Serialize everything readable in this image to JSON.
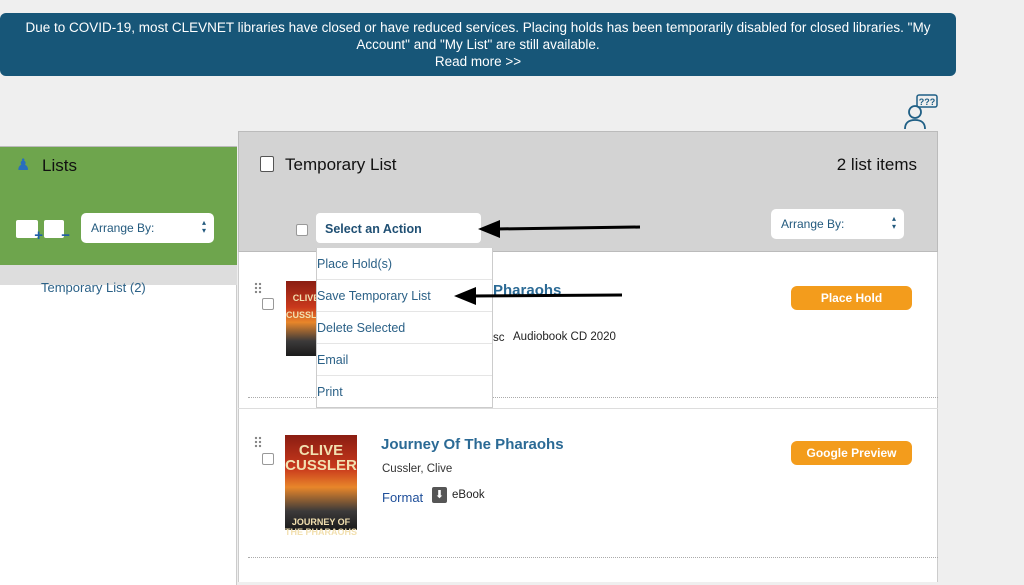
{
  "banner": {
    "text": "Due to COVID-19, most CLEVNET libraries have closed or have reduced services. Placing holds has been temporarily disabled for closed libraries. \"My Account\" and \"My List\" are still available.",
    "read_more": "Read more >>",
    "color": "#175678"
  },
  "help": {
    "icon": "help-question-person-icon",
    "label": "???"
  },
  "sidebar": {
    "title": "Lists",
    "arrange_by": "Arrange By:",
    "lists": [
      {
        "label": "Temporary List (2)"
      }
    ],
    "color": "#6ea54d"
  },
  "main": {
    "title": "Temporary List",
    "count": "2 list items",
    "action_select": "Select an Action",
    "arrange_by": "Arrange By:",
    "menu": [
      {
        "label": "Place Hold(s)"
      },
      {
        "label": "Save Temporary List"
      },
      {
        "label": "Delete Selected"
      },
      {
        "label": "Email"
      },
      {
        "label": "Print"
      }
    ],
    "items": [
      {
        "title": "Journey Of The Pharaohs",
        "title_visible": "Pharaohs",
        "format_partial": "sc",
        "format": "Audiobook CD 2020",
        "button": "Place Hold",
        "cover_text": "CLIVE CUSSLER"
      },
      {
        "title": "Journey Of The Pharaohs",
        "author": "Cussler, Clive",
        "format_label": "Format",
        "format": "eBook",
        "button": "Google Preview",
        "cover_text": "CLIVE CUSSLER",
        "cover_sub": "JOURNEY OF THE PHARAOHS"
      }
    ]
  },
  "accent": "#f39c1c"
}
